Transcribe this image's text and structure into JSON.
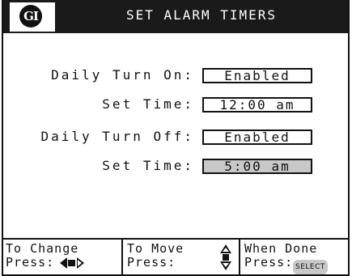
{
  "header": {
    "logo_text": "GI",
    "title": "SET ALARM TIMERS"
  },
  "settings": [
    {
      "label": "Daily Turn On:",
      "value": "Enabled",
      "selected": false
    },
    {
      "label": "Set Time:",
      "value": "12:00 am",
      "selected": false
    },
    {
      "label": "Daily Turn Off:",
      "value": "Enabled",
      "selected": false
    },
    {
      "label": "Set Time:",
      "value": "5:00 am",
      "selected": true
    }
  ],
  "footer": {
    "change": {
      "line1": "To Change",
      "line2": "Press:",
      "icon": "left-right-arrows-icon"
    },
    "move": {
      "line1": "To Move",
      "line2": "Press:",
      "icon": "up-down-arrows-icon"
    },
    "done": {
      "line1": "When Done",
      "line2": "Press:",
      "key": "SELECT"
    }
  },
  "colors": {
    "header_bg": "#1a1a1a",
    "selected_bg": "#c8c8c8"
  }
}
